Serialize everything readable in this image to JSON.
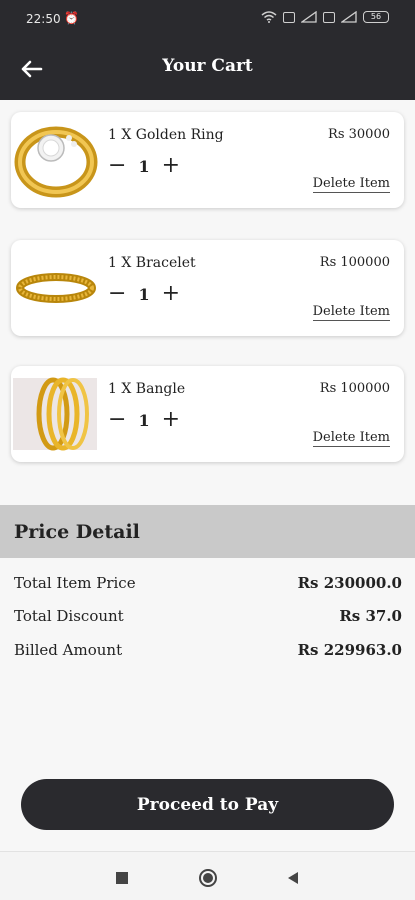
{
  "status": {
    "time": "22:50",
    "battery": "56"
  },
  "header": {
    "title": "Your Cart"
  },
  "cart": [
    {
      "name": "1 X Golden Ring",
      "price": "Rs 30000",
      "qty": "1",
      "delete_label": "Delete Item",
      "image": "golden-ring"
    },
    {
      "name": "1 X Bracelet",
      "price": "Rs 100000",
      "qty": "1",
      "delete_label": "Delete Item",
      "image": "bracelet"
    },
    {
      "name": "1 X Bangle",
      "price": "Rs 100000",
      "qty": "1",
      "delete_label": "Delete Item",
      "image": "bangle"
    }
  ],
  "qty_minus": "−",
  "qty_plus": "+",
  "price_detail": {
    "title": "Price Detail",
    "rows": [
      {
        "label": "Total Item Price",
        "value": "Rs 230000.0"
      },
      {
        "label": "Total Discount",
        "value": "Rs 37.0"
      },
      {
        "label": "Billed Amount",
        "value": "Rs 229963.0"
      }
    ]
  },
  "proceed_label": "Proceed to Pay",
  "colors": {
    "dark": "#2a2a2e",
    "gold": "#d4a017",
    "price_bg": "#c9c9c9"
  },
  "icons": [
    "back-arrow-icon",
    "alarm-icon",
    "wifi-icon",
    "signal-icon",
    "battery-icon",
    "recents-icon",
    "home-icon",
    "back-icon"
  ]
}
